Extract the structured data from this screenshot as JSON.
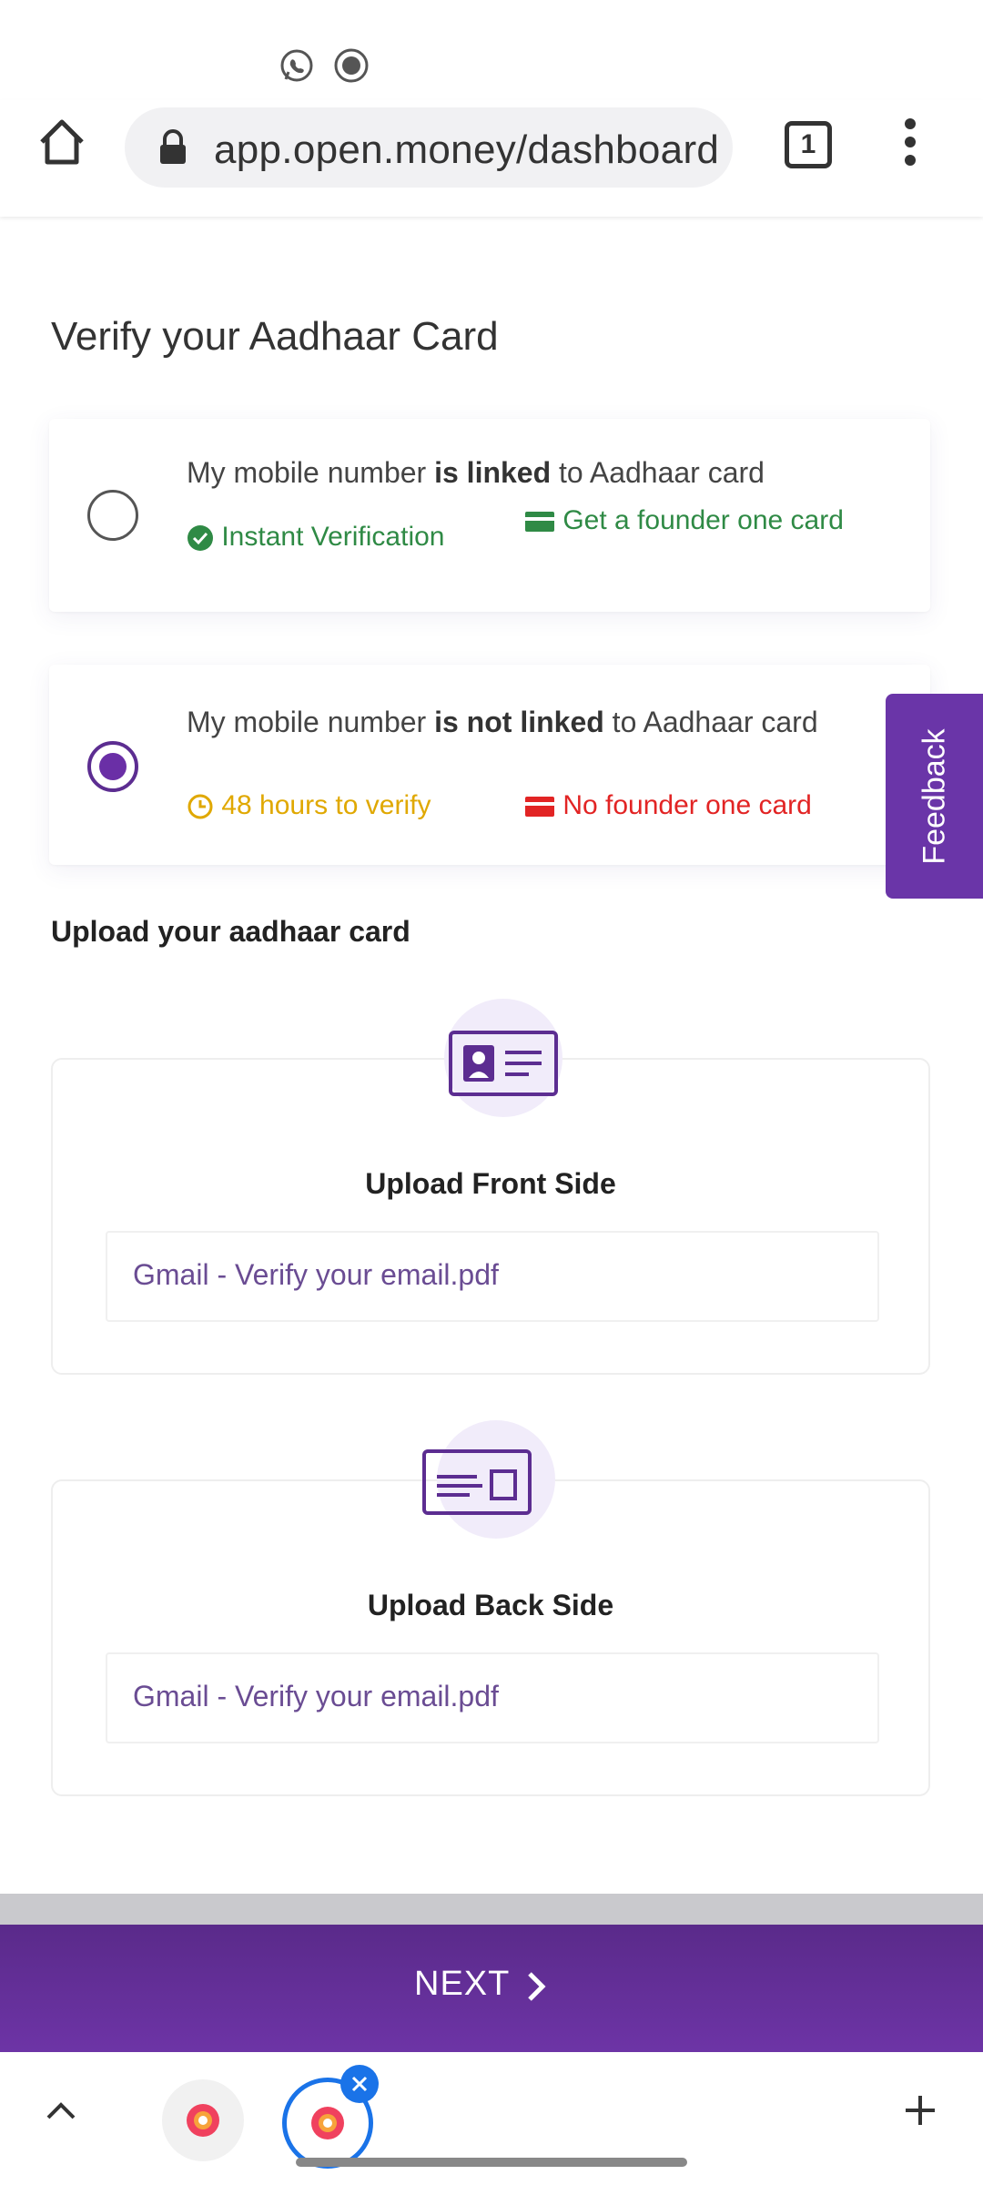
{
  "browser": {
    "url": "app.open.money/dashboard",
    "tab_count": "1"
  },
  "page": {
    "title": "Verify your Aadhaar Card"
  },
  "options": [
    {
      "text_pre": "My mobile number ",
      "text_bold": "is linked",
      "text_post": " to Aadhaar card",
      "tag1": "Instant Verification",
      "tag2": "Get a founder one card",
      "selected": false
    },
    {
      "text_pre": "My mobile number ",
      "text_bold": "is not linked",
      "text_post": " to Aadhaar card",
      "tag1": "48 hours to verify",
      "tag2": "No founder one card",
      "selected": true
    }
  ],
  "feedback": {
    "label": "Feedback"
  },
  "upload": {
    "heading": "Upload your aadhaar card",
    "front": {
      "label": "Upload Front Side",
      "file": "Gmail - Verify your email.pdf"
    },
    "back": {
      "label": "Upload Back Side",
      "file": "Gmail - Verify your email.pdf"
    }
  },
  "next_button": {
    "label": "NEXT"
  },
  "colors": {
    "brand_purple": "#6a35a8",
    "green": "#2f8a45",
    "yellow": "#e0a800",
    "red": "#e22424"
  },
  "icons": [
    "whatsapp-icon",
    "record-icon",
    "home-icon",
    "lock-icon",
    "menu-icon",
    "check-circle-icon",
    "card-icon",
    "clock-icon",
    "id-card-front-icon",
    "id-card-back-icon",
    "chevron-right-icon",
    "chevron-up-icon",
    "plus-icon",
    "close-icon"
  ]
}
